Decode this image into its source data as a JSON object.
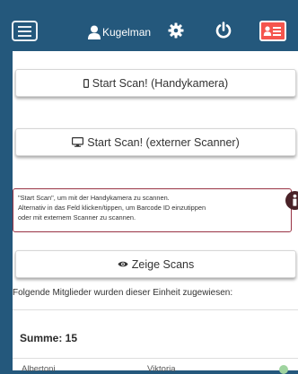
{
  "header": {
    "username": "Kugelman",
    "icons": [
      "menu-icon",
      "user-icon",
      "gear-icon",
      "power-icon",
      "id-card-icon"
    ]
  },
  "buttons": {
    "scan_phone": "Start Scan! (Handykamera)",
    "scan_external": "Start Scan! (externer Scanner)",
    "show_scans": "Zeige Scans"
  },
  "info": {
    "lines": [
      "\"Start Scan\", um mit der Handykamera zu scannen.",
      "Alternativ in das Feld klicken/tippen, um Barcode ID einzutippen",
      "oder mit externem Scanner zu scannen."
    ]
  },
  "members_text": "Folgende Mitglieder wurden dieser Einheit zugewiesen:",
  "summary": "Summe: 15",
  "table": {
    "row1": [
      "Albertoni",
      "Viktoria"
    ]
  },
  "colors": {
    "header_bg": "#24587c",
    "id_button": "#f5554d",
    "info_border": "#993344",
    "status_dot": "#9fd49f"
  }
}
